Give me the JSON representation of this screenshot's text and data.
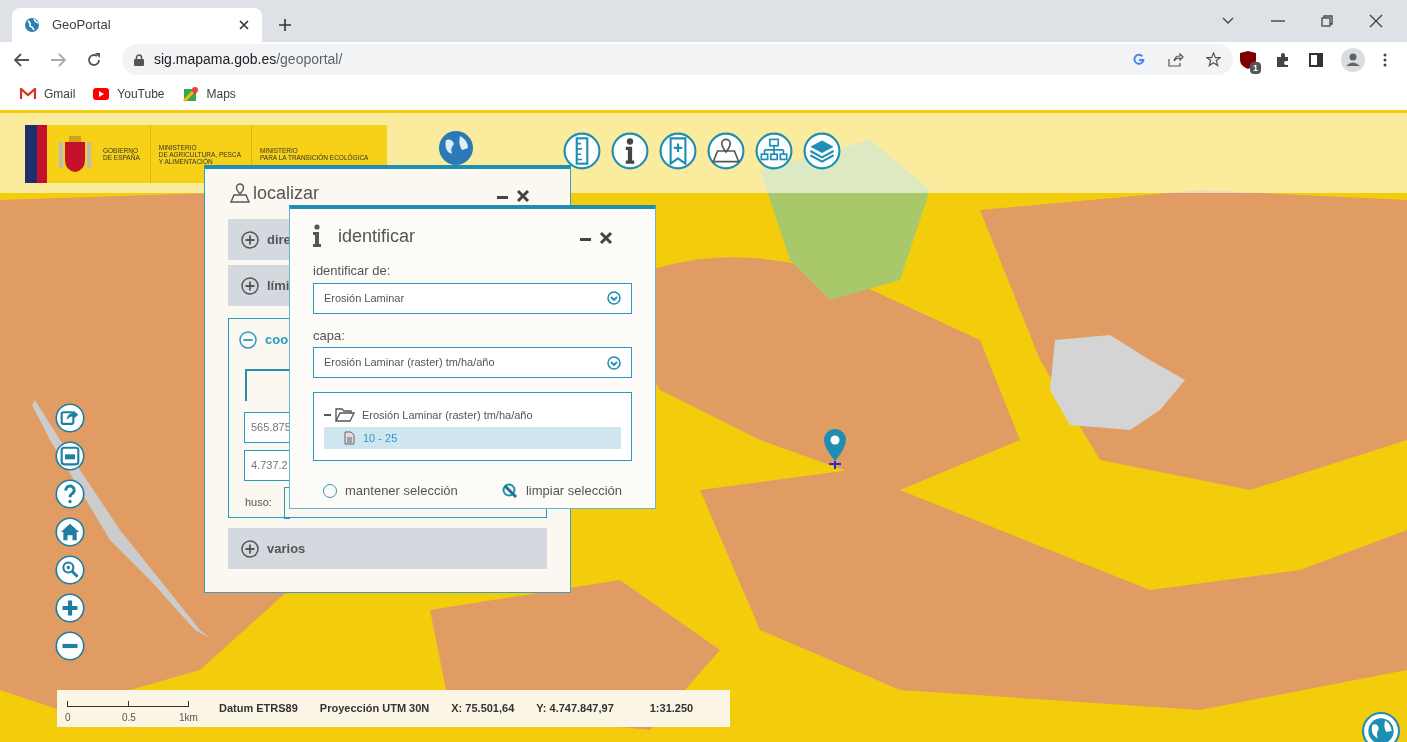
{
  "browser": {
    "tab_title": "GeoPortal",
    "url_host": "sig.mapama.gob.es",
    "url_path": "/geoportal/",
    "bookmarks": [
      "Gmail",
      "YouTube",
      "Maps"
    ],
    "extension_badge": "1"
  },
  "header": {
    "logo_lines": [
      [
        "GOBIERNO",
        "DE ESPAÑA"
      ],
      [
        "MINISTERIO",
        "DE AGRICULTURA, PESCA",
        "Y ALIMENTACIÓN"
      ],
      [
        "MINISTERIO",
        "PARA LA TRANSICIÓN ECOLÓGICA"
      ]
    ],
    "tools": [
      {
        "kind": "ruler"
      },
      {
        "kind": "info"
      },
      {
        "kind": "bookmark"
      },
      {
        "kind": "map"
      },
      {
        "kind": "tree"
      },
      {
        "kind": "layers"
      }
    ]
  },
  "side_tools": [
    {
      "kind": "share"
    },
    {
      "kind": "save"
    },
    {
      "kind": "help"
    },
    {
      "kind": "home"
    },
    {
      "kind": "zoom"
    },
    {
      "kind": "plus"
    },
    {
      "kind": "minus"
    }
  ],
  "localizar": {
    "title": "localizar",
    "sections": [
      {
        "label": "dire",
        "expanded": false
      },
      {
        "label": "lími",
        "expanded": false
      },
      {
        "label": "coo",
        "expanded": true
      },
      {
        "label": "varios",
        "expanded": false
      }
    ],
    "fields": [
      "565.875",
      "4.737.2"
    ],
    "huso_label": "huso:"
  },
  "identificar": {
    "title": "identificar",
    "source_label": "identificar de:",
    "source_value": "Erosión Laminar",
    "layer_label": "capa:",
    "layer_value": "Erosión Laminar (raster) tm/ha/año",
    "tree": [
      {
        "label": "Erosión Laminar (raster) tm/ha/año",
        "expanded": true,
        "children": [
          {
            "label": "10 - 25",
            "selected": true
          }
        ]
      }
    ],
    "keep_selection": {
      "label": "mantener selección",
      "checked": false
    },
    "clear_label": "limpiar selección"
  },
  "status_bar": {
    "scale_labels": [
      "0",
      "0.5",
      "1km"
    ],
    "datum": "Datum ETRS89",
    "projection": "Proyección UTM 30N",
    "x": "X: 75.501,64",
    "y": "Y: 4.747.847,97",
    "scale": "1:31.250"
  }
}
